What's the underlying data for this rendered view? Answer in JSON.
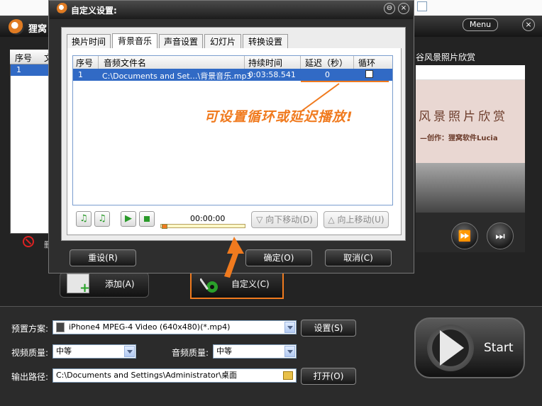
{
  "main_window": {
    "title": "狸窝",
    "menu_label": "Menu",
    "close_symbol": "×",
    "list": {
      "columns": [
        "序号",
        "文"
      ],
      "rows": [
        {
          "index": "1"
        }
      ]
    },
    "delete_partial_label": "删",
    "preview_title": "谷风景照片欣赏",
    "preview_text_1": "风景照片欣赏",
    "preview_text_2": "—创作：狸窝软件Lucia",
    "fast_forward_symbol": "⏩",
    "next_symbol": "⏭",
    "add_button": "添加(A)",
    "custom_button": "自定义(C)",
    "preset_label": "预置方案:",
    "preset_value": "iPhone4 MPEG-4 Video (640x480)(*.mp4)",
    "settings_button": "设置(S)",
    "video_quality_label": "视频质量:",
    "video_quality_value": "中等",
    "audio_quality_label": "音频质量:",
    "audio_quality_value": "中等",
    "output_path_label": "输出路径:",
    "output_path_value": "C:\\Documents and Settings\\Administrator\\桌面",
    "open_button": "打开(O)",
    "start_button": "Start"
  },
  "dialog": {
    "title": "自定义设置:",
    "minimize_symbol": "⊖",
    "close_symbol": "×",
    "tabs": [
      {
        "label": "换片时间",
        "active": false
      },
      {
        "label": "背景音乐",
        "active": true
      },
      {
        "label": "声音设置",
        "active": false
      },
      {
        "label": "幻灯片",
        "active": false
      },
      {
        "label": "转换设置",
        "active": false
      }
    ],
    "grid": {
      "columns": [
        "序号",
        "音频文件名",
        "持续时间",
        "延迟（秒）",
        "循环"
      ],
      "rows": [
        {
          "index": "1",
          "file": "C:\\Documents and Set…\\背景音乐.mp3",
          "duration": "0:03:58.541",
          "delay": "0",
          "loop": false
        }
      ]
    },
    "annotation": "可设置循环或延迟播放!",
    "player": {
      "add_icon": "♫",
      "remove_icon": "♫",
      "play_icon": "▶",
      "time": "00:00:00",
      "progress": 0.0
    },
    "move_down_button": "向下移动(D)",
    "move_up_button": "向上移动(U)",
    "reset_button": "重设(R)",
    "ok_button": "确定(O)",
    "cancel_button": "取消(C)"
  },
  "colors": {
    "accent_orange": "#f07a1e",
    "selection_blue": "#316ac5",
    "dark_bg": "#232323"
  }
}
